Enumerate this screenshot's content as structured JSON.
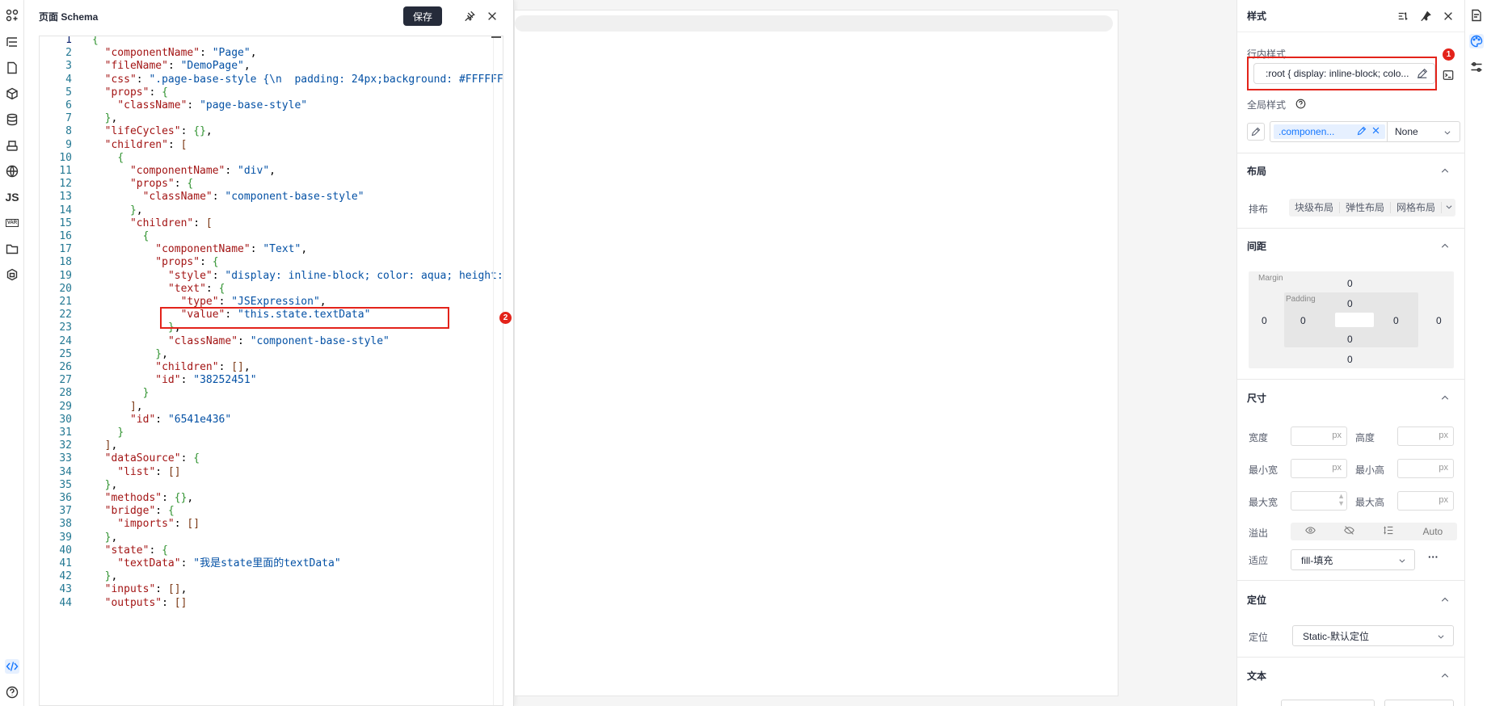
{
  "schema_panel": {
    "title": "页面 Schema",
    "save_label": "保存"
  },
  "code_lines": [
    "{",
    "  \"componentName\": \"Page\",",
    "  \"fileName\": \"DemoPage\",",
    "  \"css\": \".page-base-style {\\n  padding: 24px;background: #FFFFFF;",
    "  \"props\": {",
    "    \"className\": \"page-base-style\"",
    "  },",
    "  \"lifeCycles\": {},",
    "  \"children\": [",
    "    {",
    "      \"componentName\": \"div\",",
    "      \"props\": {",
    "        \"className\": \"component-base-style\"",
    "      },",
    "      \"children\": [",
    "        {",
    "          \"componentName\": \"Text\",",
    "          \"props\": {",
    "            \"style\": \"display: inline-block; color: aqua; height:",
    "            \"text\": {",
    "              \"type\": \"JSExpression\",",
    "              \"value\": \"this.state.textData\"",
    "            },",
    "            \"className\": \"component-base-style\"",
    "          },",
    "          \"children\": [],",
    "          \"id\": \"38252451\"",
    "        }",
    "      ],",
    "      \"id\": \"6541e436\"",
    "    }",
    "  ],",
    "  \"dataSource\": {",
    "    \"list\": []",
    "  },",
    "  \"methods\": {},",
    "  \"bridge\": {",
    "    \"imports\": []",
    "  },",
    "  \"state\": {",
    "    \"textData\": \"我是state里面的textData\"",
    "  },",
    "  \"inputs\": [],",
    "  \"outputs\": []"
  ],
  "annotations": {
    "badge_1": "1",
    "badge_2": "2"
  },
  "style_panel": {
    "title": "样式",
    "inline_style_label": "行内样式",
    "inline_style_value": ":root { display: inline-block; colo...",
    "global_style_label": "全局样式",
    "class_tag": ".componen...",
    "state_select": "None",
    "layout": {
      "title": "布局",
      "arrange_label": "排布",
      "options": [
        "块级布局",
        "弹性布局",
        "网格布局"
      ]
    },
    "spacing": {
      "title": "间距",
      "margin_label": "Margin",
      "padding_label": "Padding",
      "margin_top": "0",
      "margin_right": "0",
      "margin_bottom": "0",
      "margin_left": "0",
      "padding_top": "0",
      "padding_right": "0",
      "padding_bottom": "0",
      "padding_left": "0"
    },
    "size": {
      "title": "尺寸",
      "width_label": "宽度",
      "height_label": "高度",
      "min_width_label": "最小宽",
      "min_height_label": "最小高",
      "max_width_label": "最大宽",
      "max_height_label": "最大高",
      "unit": "px",
      "overflow_label": "溢出",
      "overflow_auto": "Auto",
      "fit_label": "适应",
      "fit_value": "fill-填充",
      "more": "···"
    },
    "position": {
      "title": "定位",
      "label": "定位",
      "value": "Static-默认定位"
    },
    "text": {
      "title": "文本"
    }
  },
  "left_rail": {
    "js_label": "JS",
    "var_label": "VAR"
  }
}
